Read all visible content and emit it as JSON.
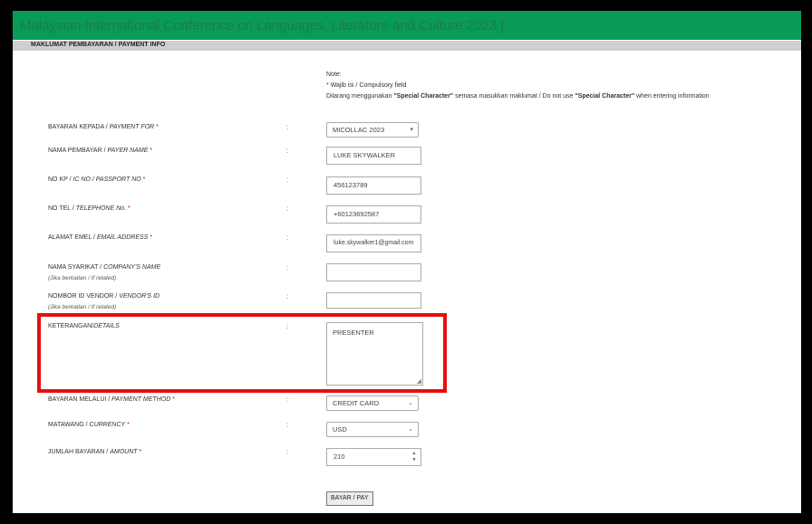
{
  "banner": {
    "title": "Malaysian International Conference on Languages, Literature and Culture 2023 |"
  },
  "section": {
    "title": "MAKLUMAT PEMBAYARAN / PAYMENT INFO"
  },
  "notes": {
    "note": "Note:",
    "required_marker": "*",
    "required_text": "Wajib isi / Compulsory field",
    "special_prefix": "Dilarang menggunakan",
    "special_term_1": "\"Special Character\"",
    "special_middle": "semasa masukkan maklumat / Do not use",
    "special_term_2": "\"Special Character\"",
    "special_suffix": "when entering information"
  },
  "fields": {
    "payment_for": {
      "label_ms": "BAYARAN KEPADA /",
      "label_en": "PAYMENT FOR",
      "required": "*",
      "value": "MICOLLAC 2023"
    },
    "payer_name": {
      "label_ms": "NAMA PEMBAYAR /",
      "label_en": "PAYER NAME",
      "required": "*",
      "value": "LUKE SKYWALKER"
    },
    "ic_passport": {
      "label_ms": "NO KP /",
      "label_en": "IC NO / PASSPORT NO",
      "required": "*",
      "value": "456123789"
    },
    "telephone": {
      "label_ms": "NO TEL /",
      "label_en": "TELEPHONE No.",
      "required": "*",
      "value": "+60123692587"
    },
    "email": {
      "label_ms": "ALAMAT EMEL /",
      "label_en": "EMAIL ADDRESS",
      "required": "*",
      "value": "luke.skywalker1@gmail.com"
    },
    "company": {
      "label_ms": "NAMA SYARIKAT /",
      "label_en": "COMPANY'S NAME",
      "sub": "(Jika berkaitan / If related)",
      "value": ""
    },
    "vendor_id": {
      "label_ms": "NOMBOR ID VENDOR /",
      "label_en": "VENDOR'S ID",
      "sub": "(Jika berkaitan / If related)",
      "value": ""
    },
    "details": {
      "label_ms": "KETERANGAN/",
      "label_en": "DETAILS",
      "value": "PRESENTER"
    },
    "payment_method": {
      "label_ms": "BAYARAN MELALUI /",
      "label_en": "PAYMENT METHOD",
      "required": "*",
      "value": "CREDIT CARD"
    },
    "currency": {
      "label_ms": "MATAWANG /",
      "label_en": "CURRENCY",
      "required": "*",
      "value": "USD"
    },
    "amount": {
      "label_ms": "JUMLAH BAYARAN /",
      "label_en": "AMOUNT",
      "required": "*",
      "value": "210"
    }
  },
  "colon": ":",
  "pay_button": "BAYAR / PAY",
  "icons": {
    "dropdown": "chevron-down-icon",
    "spinner": "spinner-icon",
    "resize": "resize-grip-icon"
  },
  "colors": {
    "banner": "#0a9a58",
    "highlight": "#e41010",
    "required": "#d00000"
  }
}
